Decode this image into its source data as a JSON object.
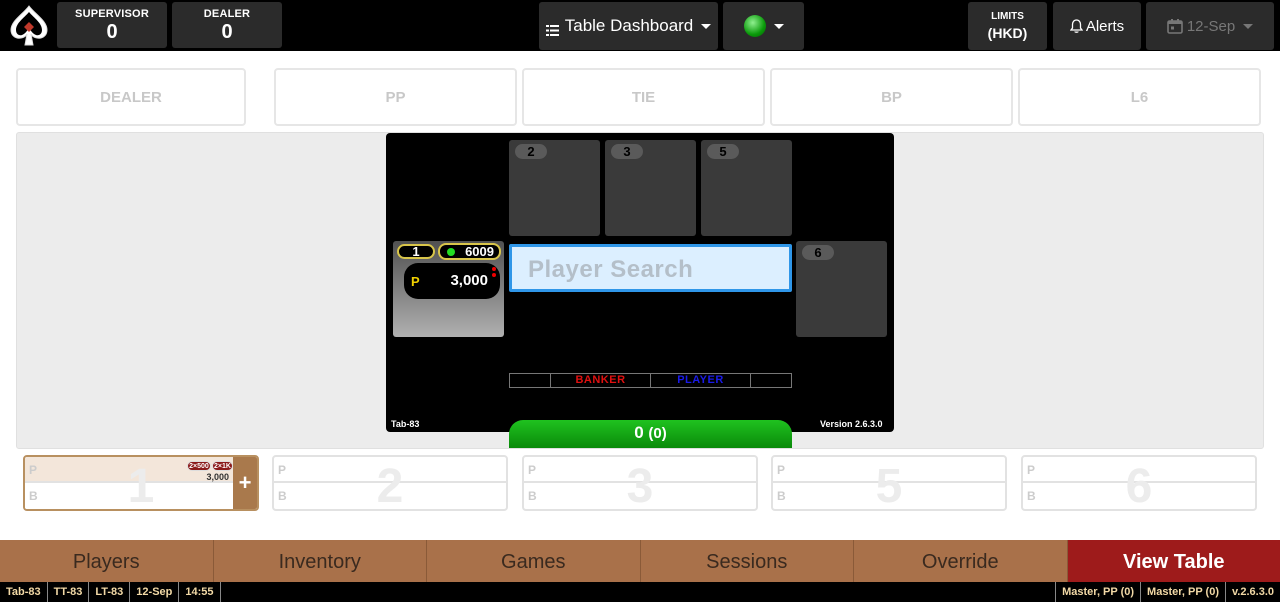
{
  "header": {
    "supervisor_label": "SUPERVISOR",
    "supervisor_value": "0",
    "dealer_label": "DEALER",
    "dealer_value": "0",
    "dashboard_label": "Table Dashboard",
    "limits_label": "LIMITS",
    "limits_currency": "(HKD)",
    "alerts_label": "Alerts",
    "date_label": "12-Sep",
    "status_color": "#11aa11"
  },
  "bet_types": [
    "DEALER",
    "PP",
    "TIE",
    "BP",
    "L6"
  ],
  "table": {
    "seats": [
      {
        "number": "2"
      },
      {
        "number": "3"
      },
      {
        "number": "5"
      },
      {
        "number": "6"
      }
    ],
    "active_seat": {
      "number": "1",
      "player_id": "6009",
      "bet_code": "P",
      "bet_amount": "3,000"
    },
    "search_placeholder": "Player Search",
    "banker_label": "BANKER",
    "player_label": "PLAYER",
    "table_id": "Tab-83",
    "version": "Version 2.6.3.0",
    "total": "0",
    "total_paren": "(0)",
    "banker_color": "#e01010",
    "player_color": "#1010e0"
  },
  "seat_cards": [
    {
      "number": "1",
      "top_label": "P",
      "bottom_label": "B",
      "badges": [
        "2×500",
        "2×1K"
      ],
      "amount": "3,000",
      "add_label": "+"
    },
    {
      "number": "2",
      "top_label": "P",
      "bottom_label": "B"
    },
    {
      "number": "3",
      "top_label": "P",
      "bottom_label": "B"
    },
    {
      "number": "5",
      "top_label": "P",
      "bottom_label": "B"
    },
    {
      "number": "6",
      "top_label": "P",
      "bottom_label": "B"
    }
  ],
  "nav": {
    "items": [
      "Players",
      "Inventory",
      "Games",
      "Sessions",
      "Override",
      "View Table"
    ]
  },
  "status_bar": {
    "left": [
      "Tab-83",
      "TT-83",
      "LT-83",
      "12-Sep",
      "14:55"
    ],
    "right": [
      "Master, PP (0)",
      "Master, PP (0)",
      "v.2.6.3.0"
    ]
  }
}
